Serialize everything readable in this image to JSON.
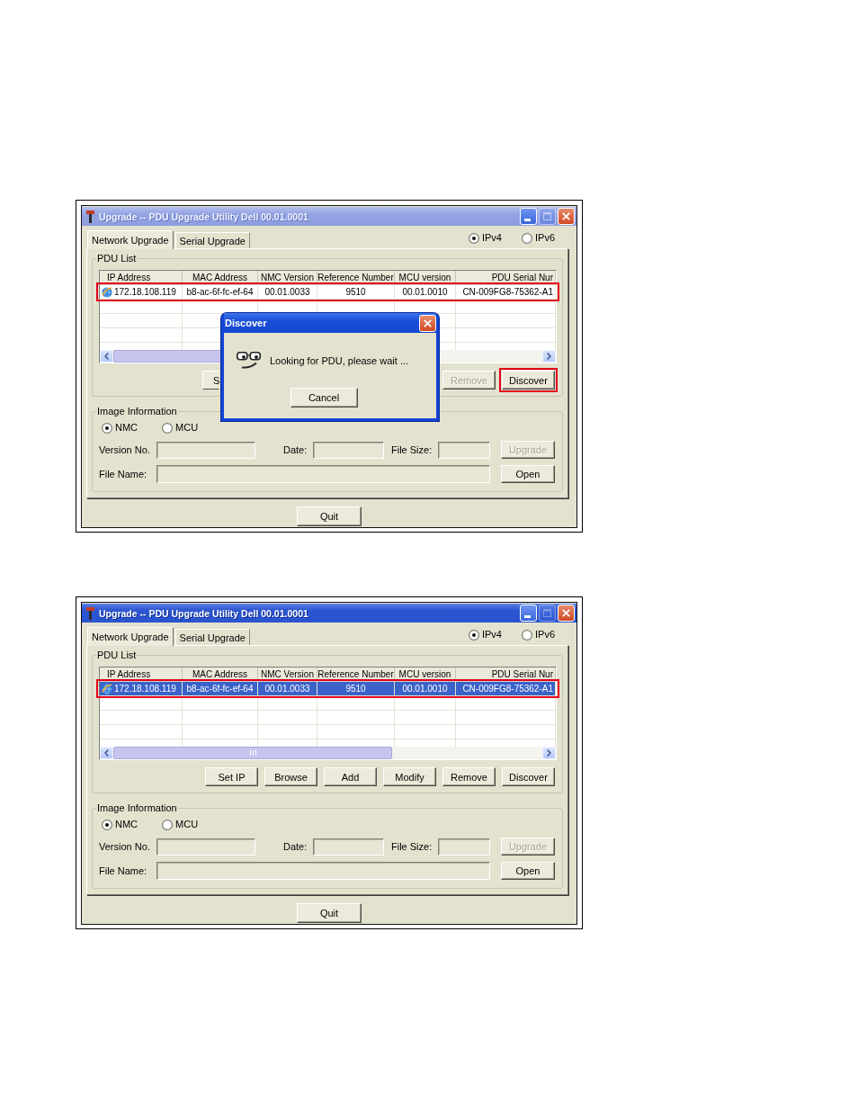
{
  "screenshots": [
    {
      "window": {
        "title": "Upgrade -- PDU Upgrade Utility Dell 00.01.0001",
        "active": false,
        "title_buttons": [
          {
            "kind": "minimize",
            "disabled": false
          },
          {
            "kind": "maximize",
            "disabled": true
          },
          {
            "kind": "close",
            "disabled": false
          }
        ]
      },
      "tabs": [
        {
          "label": "Network Upgrade",
          "selected": true
        },
        {
          "label": "Serial Upgrade",
          "selected": false
        }
      ],
      "ip_versions": [
        {
          "label": "IPv4",
          "selected": true
        },
        {
          "label": "IPv6",
          "selected": false
        }
      ],
      "pdu_list": {
        "title": "PDU List",
        "columns": [
          "IP Address",
          "MAC Address",
          "NMC Version",
          "Reference Number",
          "MCU version",
          "PDU Serial Nur"
        ],
        "rows": [
          {
            "cells": [
              "172.18.108.119",
              "b8-ac-6f-fc-ef-64",
              "00.01.0033",
              "9510",
              "00.01.0010",
              "CN-009FG8-75362-A1"
            ],
            "selected": false,
            "highlighted": true
          }
        ],
        "buttons": [
          {
            "label": "S",
            "kind": "cut",
            "disabled": false,
            "highlighted": false
          },
          {
            "label": "Remove",
            "kind": "full",
            "disabled": true,
            "highlighted": false
          },
          {
            "label": "Discover",
            "kind": "full",
            "disabled": false,
            "highlighted": true
          }
        ]
      },
      "image_information": {
        "title": "Image Information",
        "targets": [
          {
            "label": "NMC",
            "selected": true
          },
          {
            "label": "MCU",
            "selected": false
          }
        ],
        "version_label": "Version No.",
        "date_label": "Date:",
        "file_size_label": "File Size:",
        "upgrade_button": {
          "label": "Upgrade",
          "disabled": true
        },
        "file_name_label": "File Name:",
        "open_button": {
          "label": "Open",
          "disabled": false
        }
      },
      "quit_button": "Quit",
      "dialog": {
        "title": "Discover",
        "message": "Looking for PDU, please wait ...",
        "button": "Cancel"
      }
    },
    {
      "window": {
        "title": "Upgrade -- PDU Upgrade Utility Dell 00.01.0001",
        "active": true,
        "title_buttons": [
          {
            "kind": "minimize",
            "disabled": false
          },
          {
            "kind": "maximize",
            "disabled": true
          },
          {
            "kind": "close",
            "disabled": false
          }
        ]
      },
      "tabs": [
        {
          "label": "Network Upgrade",
          "selected": true
        },
        {
          "label": "Serial Upgrade",
          "selected": false
        }
      ],
      "ip_versions": [
        {
          "label": "IPv4",
          "selected": true
        },
        {
          "label": "IPv6",
          "selected": false
        }
      ],
      "pdu_list": {
        "title": "PDU List",
        "columns": [
          "IP Address",
          "MAC Address",
          "NMC Version",
          "Reference Number",
          "MCU version",
          "PDU Serial Nur"
        ],
        "rows": [
          {
            "cells": [
              "172.18.108.119",
              "b8-ac-6f-fc-ef-64",
              "00.01.0033",
              "9510",
              "00.01.0010",
              "CN-009FG8-75362-A1"
            ],
            "selected": true,
            "highlighted": true
          }
        ],
        "buttons": [
          {
            "label": "Set IP",
            "kind": "full",
            "disabled": false,
            "highlighted": false
          },
          {
            "label": "Browse",
            "kind": "full",
            "disabled": false,
            "highlighted": false
          },
          {
            "label": "Add",
            "kind": "full",
            "disabled": false,
            "highlighted": false
          },
          {
            "label": "Modify",
            "kind": "full",
            "disabled": false,
            "highlighted": false
          },
          {
            "label": "Remove",
            "kind": "full",
            "disabled": false,
            "highlighted": false
          },
          {
            "label": "Discover",
            "kind": "full",
            "disabled": false,
            "highlighted": false
          }
        ]
      },
      "image_information": {
        "title": "Image Information",
        "targets": [
          {
            "label": "NMC",
            "selected": true
          },
          {
            "label": "MCU",
            "selected": false
          }
        ],
        "version_label": "Version No.",
        "date_label": "Date:",
        "file_size_label": "File Size:",
        "upgrade_button": {
          "label": "Upgrade",
          "disabled": true
        },
        "file_name_label": "File Name:",
        "open_button": {
          "label": "Open",
          "disabled": false
        }
      },
      "quit_button": "Quit"
    }
  ]
}
